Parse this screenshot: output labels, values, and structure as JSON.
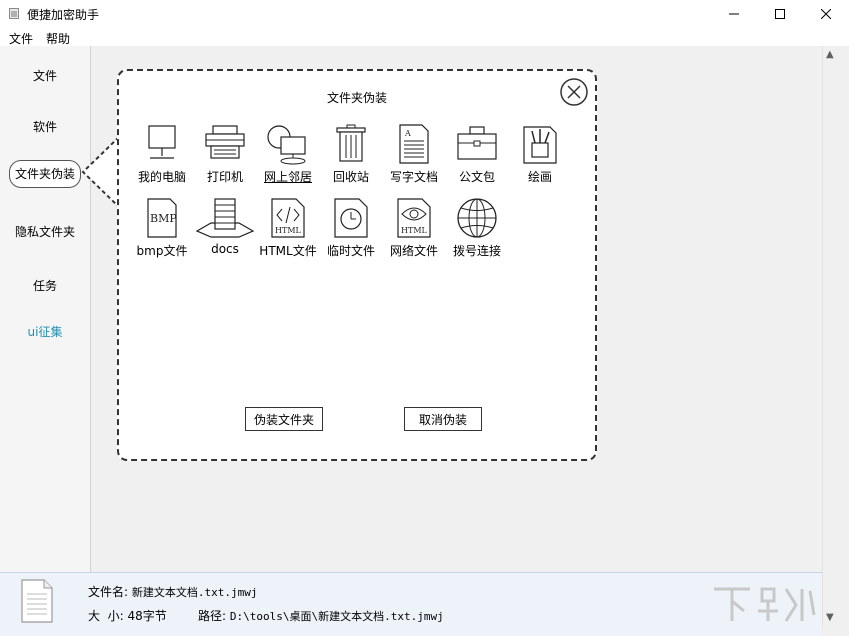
{
  "window": {
    "title": "便捷加密助手"
  },
  "menu": {
    "file": "文件",
    "help": "帮助"
  },
  "sidebar": {
    "items": [
      {
        "label": "文件"
      },
      {
        "label": "软件"
      },
      {
        "label": "文件夹伪装"
      },
      {
        "label": "隐私文件夹"
      },
      {
        "label": "任务"
      },
      {
        "label": "ui征集"
      }
    ]
  },
  "popup": {
    "title": "文件夹伪装",
    "icons": [
      {
        "label": "我的电脑",
        "icon": "computer-icon"
      },
      {
        "label": "打印机",
        "icon": "printer-icon"
      },
      {
        "label": "网上邻居",
        "icon": "network-icon"
      },
      {
        "label": "回收站",
        "icon": "recycle-bin-icon"
      },
      {
        "label": "写字文档",
        "icon": "document-icon"
      },
      {
        "label": "公文包",
        "icon": "briefcase-icon"
      },
      {
        "label": "绘画",
        "icon": "paint-icon"
      },
      {
        "label": "bmp文件",
        "icon": "bmp-file-icon"
      },
      {
        "label": "docs",
        "icon": "docs-icon"
      },
      {
        "label": "HTML文件",
        "icon": "html-file-icon"
      },
      {
        "label": "临时文件",
        "icon": "temp-file-icon"
      },
      {
        "label": "网络文件",
        "icon": "web-file-icon"
      },
      {
        "label": "拨号连接",
        "icon": "globe-icon"
      }
    ],
    "disguise_button": "伪装文件夹",
    "cancel_button": "取消伪装"
  },
  "footer": {
    "name_label": "文件名:",
    "name_value": "新建文本文档.txt.jmwj",
    "size_label": "大  小:",
    "size_value": "48字节",
    "path_label": "路径:",
    "path_value": "D:\\tools\\桌面\\新建文本文档.txt.jmwj"
  },
  "colors": {
    "link": "#1e8fb5",
    "footer_bg": "#eef3fa"
  }
}
